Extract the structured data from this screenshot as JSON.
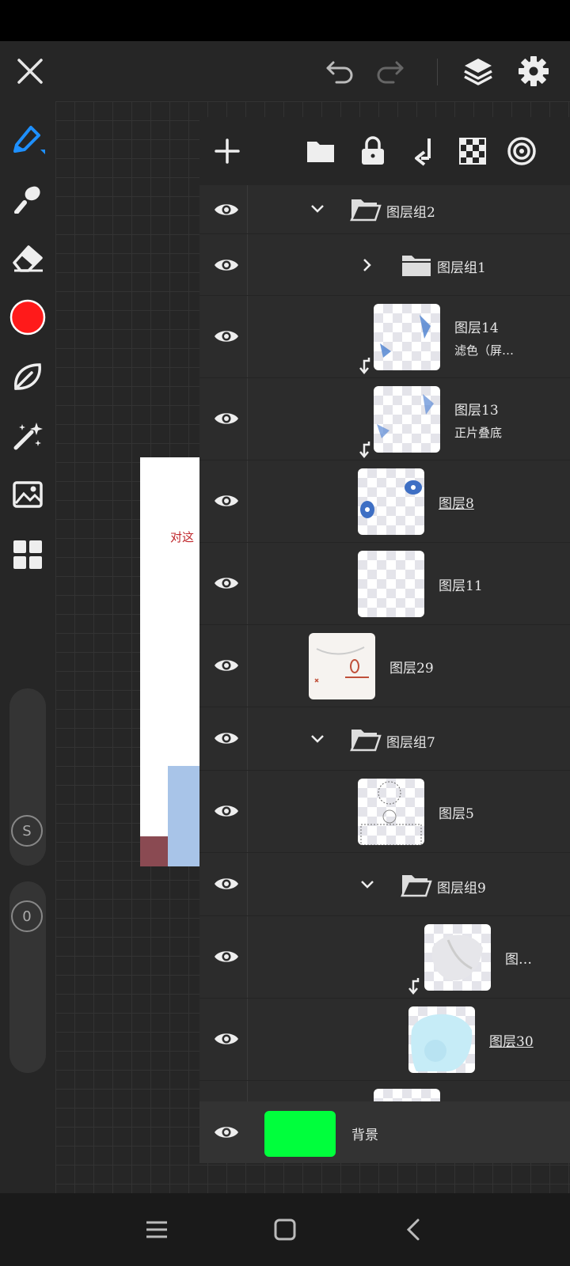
{
  "layers": [
    {
      "name": "图层组2",
      "type": "group",
      "expanded": true
    },
    {
      "name": "图层组1",
      "type": "group",
      "expanded": false
    },
    {
      "name": "图层14",
      "sub": "滤色（屏…",
      "type": "layer",
      "clipped": true
    },
    {
      "name": "图层13",
      "sub": "正片叠底",
      "type": "layer",
      "clipped": true
    },
    {
      "name": "图层8",
      "type": "layer"
    },
    {
      "name": "图层11",
      "type": "layer"
    },
    {
      "name": "图层29",
      "type": "layer"
    },
    {
      "name": "图层组7",
      "type": "group",
      "expanded": true
    },
    {
      "name": "图层5",
      "type": "layer"
    },
    {
      "name": "图层组9",
      "type": "group",
      "expanded": true
    },
    {
      "name": "图…",
      "type": "layer",
      "clipped": true
    },
    {
      "name": "图层30",
      "type": "layer"
    }
  ],
  "background_layer": {
    "name": "背景",
    "color": "#00ff3c"
  },
  "canvas_text": "对这",
  "colors": {
    "brush_color": "#ff1a1a",
    "accent": "#1e90ff"
  },
  "slider_labels": {
    "size": "S",
    "opacity": "0"
  },
  "icons": {
    "top_bar": [
      "close-icon",
      "undo-icon",
      "redo-icon",
      "layers-icon",
      "gear-icon"
    ],
    "tools": [
      "brush-icon",
      "smudge-icon",
      "eraser-icon",
      "color-swatch",
      "leaf-icon",
      "magic-wand-icon",
      "image-icon",
      "grid-icon"
    ],
    "panel": [
      "add-icon",
      "folder-icon",
      "lock-icon",
      "merge-down-icon",
      "transparency-icon",
      "target-icon"
    ]
  }
}
